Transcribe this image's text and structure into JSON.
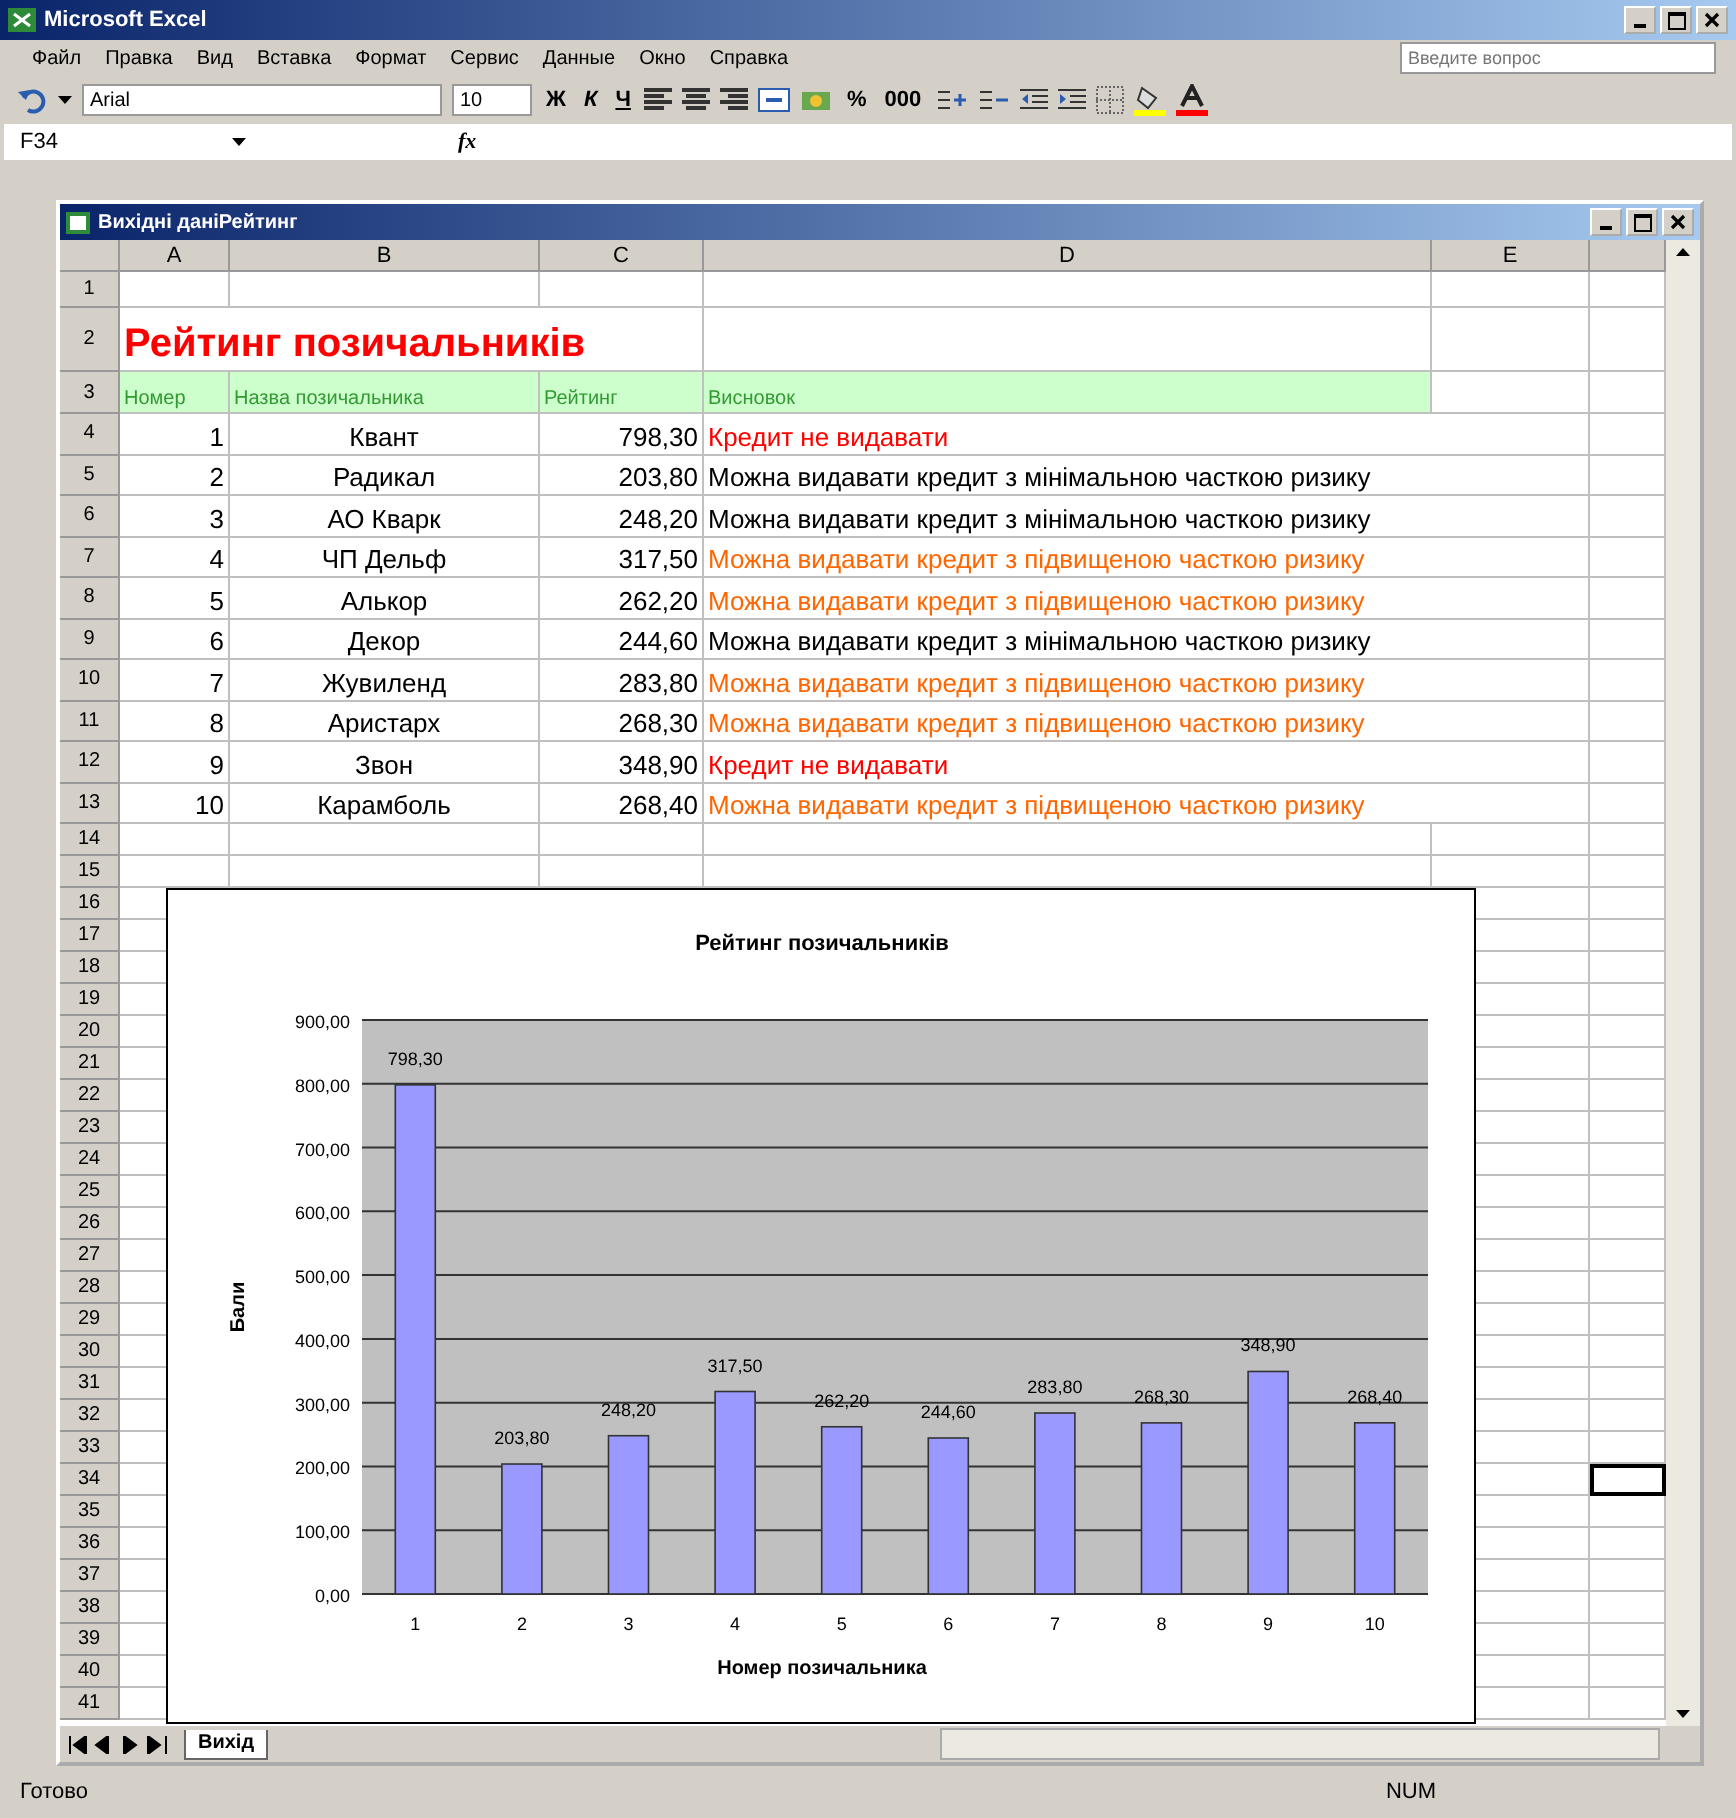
{
  "window": {
    "title": "Microsoft Excel"
  },
  "menu": [
    "Файл",
    "Правка",
    "Вид",
    "Вставка",
    "Формат",
    "Сервис",
    "Данные",
    "Окно",
    "Справка"
  ],
  "help_field": {
    "placeholder": "Введите вопрос"
  },
  "toolbar": {
    "font": "Arial",
    "size": "10",
    "format_buttons": [
      "Ж",
      "К",
      "Ч"
    ],
    "percent": "%",
    "thousands": "000"
  },
  "formula_bar": {
    "name_box": "F34",
    "fx": "fx"
  },
  "workbook": {
    "title": "Вихідні даніРейтинг"
  },
  "sheet": {
    "columns": [
      "A",
      "B",
      "C",
      "D",
      "E"
    ],
    "row_numbers": [
      "1",
      "2",
      "3",
      "4",
      "5",
      "6",
      "7",
      "8",
      "9",
      "10",
      "11",
      "12",
      "13",
      "14",
      "15",
      "16",
      "17",
      "18",
      "19",
      "20",
      "21",
      "22",
      "23",
      "24",
      "25",
      "26",
      "27",
      "28",
      "29",
      "30",
      "31",
      "32",
      "33",
      "34",
      "35",
      "36",
      "37",
      "38",
      "39",
      "40",
      "41"
    ],
    "title": "Рейтинг позичальників",
    "header": [
      "Номер",
      "Назва позичальника",
      "Рейтинг",
      "Висновок"
    ],
    "rows": [
      {
        "number": "1",
        "name": "Квант",
        "rating": "798,30",
        "conclusion": "Кредит не видавати",
        "color": "#ff0000"
      },
      {
        "number": "2",
        "name": "Радикал",
        "rating": "203,80",
        "conclusion": "Можна видавати кредит з мінімальною часткою ризику",
        "color": "#000000"
      },
      {
        "number": "3",
        "name": "АО Кварк",
        "rating": "248,20",
        "conclusion": "Можна видавати кредит з мінімальною часткою ризику",
        "color": "#000000"
      },
      {
        "number": "4",
        "name": "ЧП Дельф",
        "rating": "317,50",
        "conclusion": "Можна видавати кредит з підвищеною часткою ризику",
        "color": "#ff6600"
      },
      {
        "number": "5",
        "name": "Алькор",
        "rating": "262,20",
        "conclusion": "Можна видавати кредит з підвищеною часткою ризику",
        "color": "#ff6600"
      },
      {
        "number": "6",
        "name": "Декор",
        "rating": "244,60",
        "conclusion": "Можна видавати кредит з мінімальною часткою ризику",
        "color": "#000000"
      },
      {
        "number": "7",
        "name": "Жувиленд",
        "rating": "283,80",
        "conclusion": "Можна видавати кредит з підвищеною часткою ризику",
        "color": "#ff6600"
      },
      {
        "number": "8",
        "name": "Аристарх",
        "rating": "268,30",
        "conclusion": "Можна видавати кредит з підвищеною часткою ризику",
        "color": "#ff6600"
      },
      {
        "number": "9",
        "name": "Звон",
        "rating": "348,90",
        "conclusion": "Кредит не видавати",
        "color": "#ff0000"
      },
      {
        "number": "10",
        "name": "Карамболь",
        "rating": "268,40",
        "conclusion": "Можна видавати кредит з підвищеною часткою ризику",
        "color": "#ff6600"
      }
    ],
    "chart_data": {
      "type": "bar",
      "title": "Рейтинг позичальників",
      "xlabel": "Номер позичальника",
      "ylabel": "Бали",
      "categories": [
        "1",
        "2",
        "3",
        "4",
        "5",
        "6",
        "7",
        "8",
        "9",
        "10"
      ],
      "values": [
        798.3,
        203.8,
        248.2,
        317.5,
        262.2,
        244.6,
        283.8,
        268.3,
        348.9,
        268.4
      ],
      "ylim": [
        0,
        900
      ],
      "yticks": [
        {
          "value": 0,
          "label": "0,00"
        },
        {
          "value": 100,
          "label": "100,00"
        },
        {
          "value": 200,
          "label": "200,00"
        },
        {
          "value": 300,
          "label": "300,00"
        },
        {
          "value": 400,
          "label": "400,00"
        },
        {
          "value": 500,
          "label": "500,00"
        },
        {
          "value": 600,
          "label": "600,00"
        },
        {
          "value": 700,
          "label": "700,00"
        },
        {
          "value": 800,
          "label": "800,00"
        },
        {
          "value": 900,
          "label": "900,00"
        }
      ],
      "value_labels": [
        "798,30",
        "203,80",
        "248,20",
        "317,50",
        "262,20",
        "244,60",
        "283,80",
        "268,30",
        "348,90",
        "268,40"
      ],
      "grid": true
    },
    "sheet_tab": "Вихід"
  },
  "status_bar": {
    "left": "Готово",
    "right": "NUM"
  }
}
